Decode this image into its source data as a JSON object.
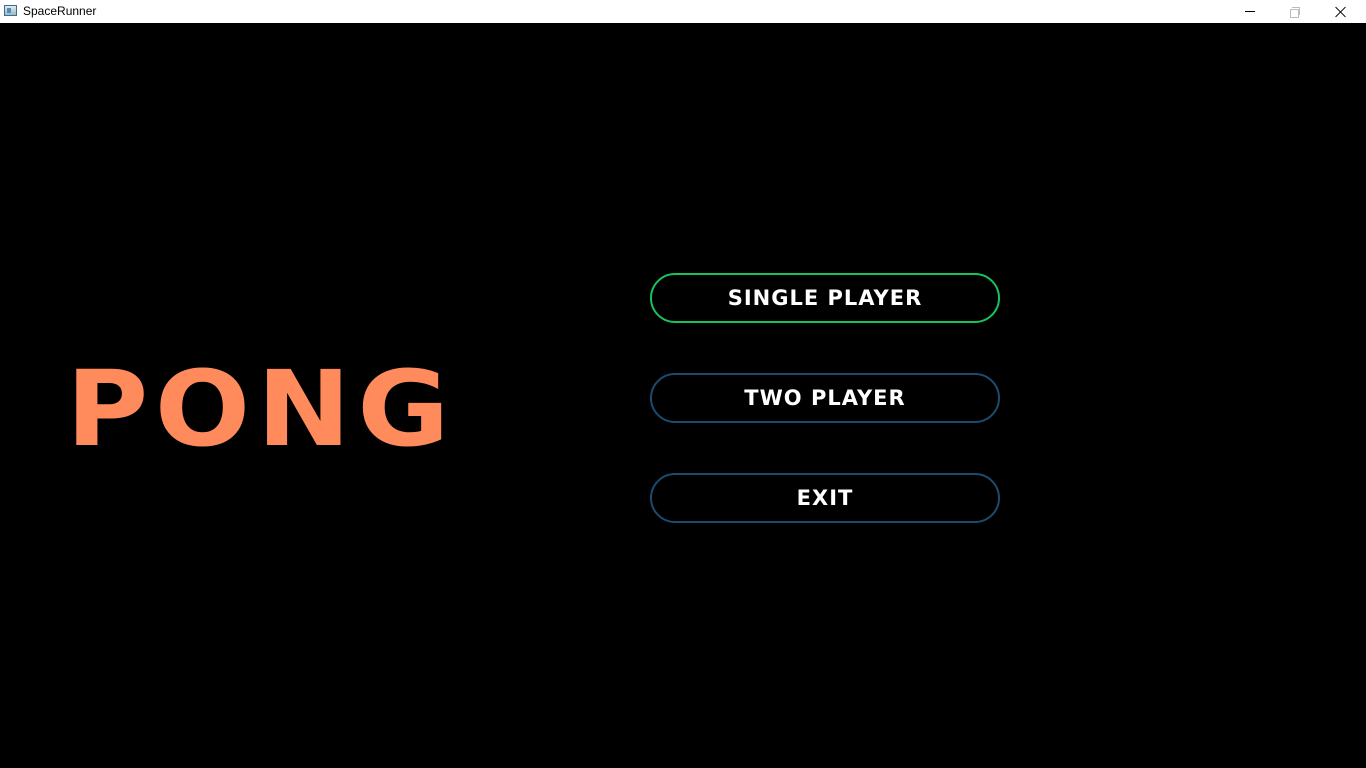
{
  "window": {
    "title": "SpaceRunner",
    "icon": "app-window-icon",
    "controls": {
      "minimize_icon": "minimize-icon",
      "maximize_icon": "restore-icon",
      "close_icon": "close-icon"
    }
  },
  "game": {
    "title": "PONG",
    "title_color": "#ff8a5c",
    "menu": [
      {
        "label": "SINGLE PLAYER",
        "selected": true
      },
      {
        "label": "TWO PLAYER",
        "selected": false
      },
      {
        "label": "EXIT",
        "selected": false
      }
    ],
    "colors": {
      "background": "#000000",
      "button_border": "#1d4b6e",
      "button_border_selected": "#19c25a",
      "button_text": "#ffffff"
    }
  }
}
